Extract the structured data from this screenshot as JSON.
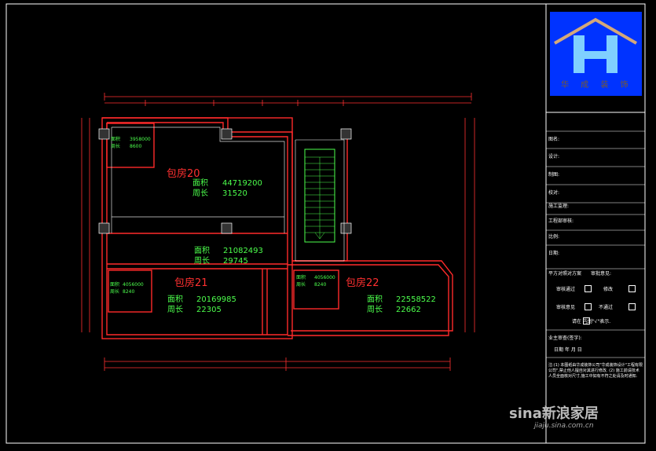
{
  "title_block": {
    "logo_text": "华 成 装 饰",
    "fields": [
      "图名:",
      "设计:",
      "制图:",
      "校对:",
      "施工监理:",
      "工程部审核:",
      "比例:",
      "日期:"
    ],
    "plan_label": "平方对照对方案",
    "approval_label": "审批意见:",
    "options": [
      "审核通过",
      "修改",
      "审核意见",
      "不通过"
    ],
    "tick_hint": "请在 内划\"√\"表示.",
    "owner_confirm": "业主审查(签字):",
    "date_row": "日期        年    月    日",
    "note": "注:(1) 本图纸由华成装饰公司\"华成装饰设计\"工程有限公司\",禁止他人擅自对其进行修改. (2) 施工前请技术人员全面核对尺寸,施工中如有不符之处请及时通知."
  },
  "rooms": [
    {
      "name": "包房20",
      "area_label": "面积",
      "area": "44719200",
      "perim_label": "周长",
      "perim": "31520"
    },
    {
      "name": "包房21",
      "area_label": "面积",
      "area": "20169985",
      "perim_label": "周长",
      "perim": "22305"
    },
    {
      "name": "包房22",
      "area_label": "面积",
      "area": "22558522",
      "perim_label": "周长",
      "perim": "22662"
    }
  ],
  "corridor": {
    "area_label": "面积",
    "area": "21082493",
    "perim_label": "周长",
    "perim": "29745"
  },
  "small_rooms": [
    {
      "area_label": "面积",
      "area": "3958000",
      "perim_label": "周长",
      "perim": "8600"
    },
    {
      "area_label": "面积",
      "area": "4056000",
      "perim_label": "周长",
      "perim": "8240"
    },
    {
      "area_label": "面积",
      "area": "4056000",
      "perim_label": "周长",
      "perim": "8240"
    }
  ],
  "watermark": {
    "brand": "sina新浪家居",
    "url": "jiaju.sina.com.cn"
  }
}
